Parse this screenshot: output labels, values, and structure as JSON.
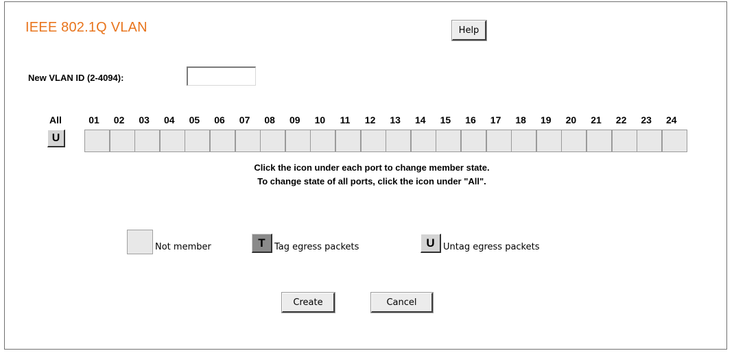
{
  "page": {
    "title": "IEEE 802.1Q VLAN",
    "help_label": "Help"
  },
  "vlan_id": {
    "label": "New VLAN ID (2-4094):",
    "value": "",
    "placeholder": ""
  },
  "ports": {
    "all_label": "All",
    "all_state": "U",
    "labels": [
      "01",
      "02",
      "03",
      "04",
      "05",
      "06",
      "07",
      "08",
      "09",
      "10",
      "11",
      "12",
      "13",
      "14",
      "15",
      "16",
      "17",
      "18",
      "19",
      "20",
      "21",
      "22",
      "23",
      "24"
    ],
    "states": [
      "",
      "",
      "",
      "",
      "",
      "",
      "",
      "",
      "",
      "",
      "",
      "",
      "",
      "",
      "",
      "",
      "",
      "",
      "",
      "",
      "",
      "",
      "",
      ""
    ]
  },
  "instructions": {
    "line1": "Click the icon under each port to change member state.",
    "line2": "To change state of all ports, click the icon under \"All\"."
  },
  "legend": {
    "not_member": "Not member",
    "tag_symbol": "T",
    "tag_label": "Tag egress packets",
    "untag_symbol": "U",
    "untag_label": "Untag egress packets"
  },
  "actions": {
    "create_label": "Create",
    "cancel_label": "Cancel"
  },
  "colors": {
    "title": "#e8741c",
    "tile_bg": "#e8e8e8",
    "tag_bg": "#8a8a8a",
    "untag_bg": "#d4d4d4"
  }
}
